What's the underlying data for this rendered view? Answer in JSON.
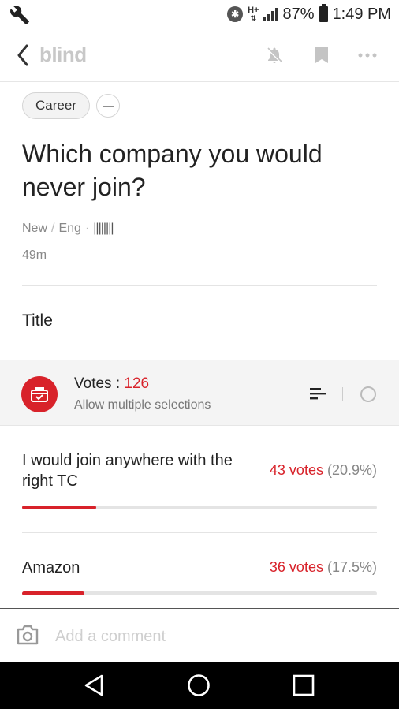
{
  "status_bar": {
    "battery": "87%",
    "time": "1:49 PM",
    "network": "H+"
  },
  "app": {
    "brand": "blind"
  },
  "post": {
    "category_chip": "Career",
    "title": "Which company you would never join?",
    "meta": {
      "company": "New",
      "separator": "/",
      "lang": "Eng",
      "dot": "·",
      "author": "||||||||"
    },
    "time_ago": "49m",
    "subtitle": "Title"
  },
  "poll": {
    "votes_label": "Votes :",
    "votes_count": "126",
    "allow_multiple": "Allow multiple selections",
    "options": [
      {
        "label": "I would join anywhere with the right TC",
        "votes": "43 votes",
        "percent": "(20.9%)",
        "fraction": 0.209
      },
      {
        "label": "Amazon",
        "votes": "36 votes",
        "percent": "(17.5%)",
        "fraction": 0.175
      }
    ]
  },
  "comment": {
    "placeholder": "Add a comment"
  },
  "colors": {
    "accent": "#d8222a",
    "brand_gray": "#c8c8c8",
    "navbar": "#000000"
  },
  "icons": {
    "status": [
      "wrench-icon",
      "bluetooth-icon",
      "signal-icon",
      "battery-icon"
    ],
    "header": [
      "back-chevron-icon",
      "bell-off-icon",
      "bookmark-icon",
      "more-dots-icon"
    ],
    "poll": [
      "ballot-box-icon",
      "sort-lines-icon",
      "radio-circle-icon"
    ],
    "comment": [
      "camera-icon"
    ],
    "navbar": [
      "back-triangle-icon",
      "home-circle-icon",
      "recents-square-icon"
    ]
  }
}
